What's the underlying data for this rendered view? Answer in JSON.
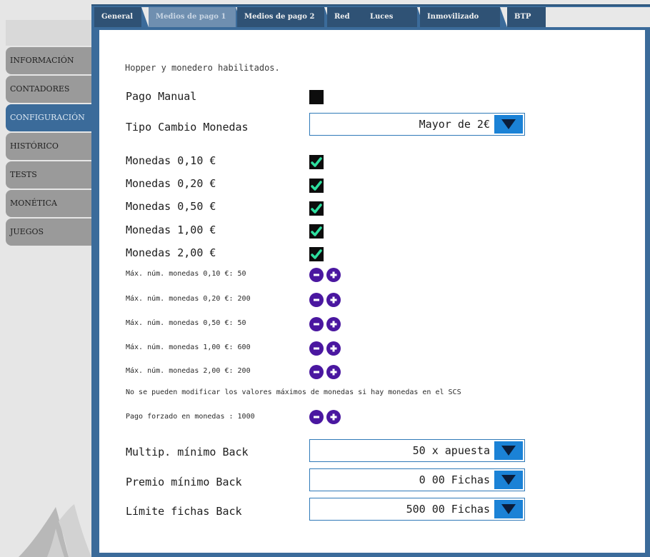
{
  "sidebar": {
    "items": [
      {
        "label": "INFORMACIÓN",
        "active": false
      },
      {
        "label": "CONTADORES",
        "active": false
      },
      {
        "label": "CONFIGURACIÓN",
        "active": true
      },
      {
        "label": "HISTÓRICO",
        "active": false
      },
      {
        "label": "TESTS",
        "active": false
      },
      {
        "label": "MONÉTICA",
        "active": false
      },
      {
        "label": "JUEGOS",
        "active": false
      }
    ]
  },
  "tabs": [
    {
      "label": "General",
      "active": false
    },
    {
      "label": "Medios de pago 1",
      "active": true
    },
    {
      "label": "Medios de pago 2",
      "active": false
    },
    {
      "label": "Red",
      "active": false
    },
    {
      "label": "Luces",
      "active": false
    },
    {
      "label": "Inmovilizado",
      "active": false
    },
    {
      "label": "BTP",
      "active": false
    }
  ],
  "content": {
    "info_text": "Hopper y monedero habilitados.",
    "pago_manual": {
      "label": "Pago Manual",
      "checked": false
    },
    "tipo_cambio": {
      "label": "Tipo Cambio Monedas",
      "value": "Mayor de 2€"
    },
    "coins": [
      {
        "label": "Monedas 0,10 €",
        "checked": true
      },
      {
        "label": "Monedas 0,20 €",
        "checked": true
      },
      {
        "label": "Monedas 0,50 €",
        "checked": true
      },
      {
        "label": "Monedas 1,00 €",
        "checked": true
      },
      {
        "label": "Monedas 2,00 €",
        "checked": true
      }
    ],
    "max_coins": [
      {
        "label": "Máx. núm. monedas 0,10 €: 50"
      },
      {
        "label": "Máx. núm. monedas 0,20 €: 200"
      },
      {
        "label": "Máx. núm. monedas 0,50 €: 50"
      },
      {
        "label": "Máx. núm. monedas 1,00 €: 600"
      },
      {
        "label": "Máx. núm. monedas 2,00 €: 200"
      }
    ],
    "warning": "No se pueden modificar los valores máximos de monedas si hay monedas en el SCS",
    "pago_forzado": {
      "label": "Pago forzado en monedas : 1000"
    },
    "back_settings": [
      {
        "label": "Multip. mínimo Back",
        "value": "50 x apuesta"
      },
      {
        "label": "Premio mínimo Back",
        "value": "0 00 Fichas"
      },
      {
        "label": "Límite fichas Back",
        "value": "500 00 Fichas"
      }
    ]
  },
  "colors": {
    "frame_blue": "#3b6b9a",
    "dropdown_blue": "#1b82d6",
    "stepper_purple": "#4a17a0",
    "check_green": "#2ee0a0"
  },
  "icons": {
    "check": "check-icon",
    "dropdown": "triangle-down-icon",
    "minus": "minus-icon",
    "plus": "plus-icon"
  }
}
